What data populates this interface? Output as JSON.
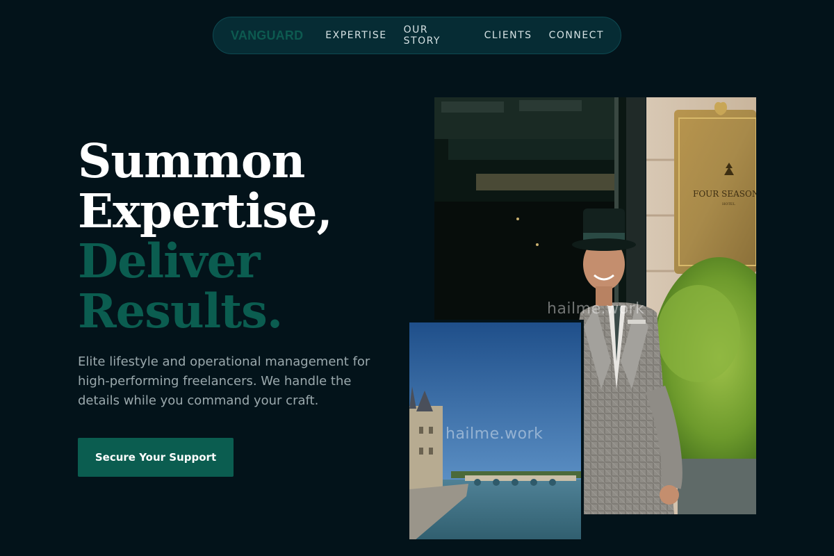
{
  "nav": {
    "brand": "VANGUARD",
    "links": [
      "EXPERTISE",
      "OUR STORY",
      "CLIENTS",
      "CONNECT"
    ]
  },
  "hero": {
    "headline_line1": "Summon",
    "headline_line2": "Expertise,",
    "headline_line3": "Deliver",
    "headline_line4": "Results.",
    "tagline": "Elite lifestyle and operational management for high-performing freelancers. We handle the details while you command your craft.",
    "cta_label": "Secure Your Support"
  },
  "images": {
    "main_sign_text": "FOUR SEASONS",
    "main_sign_sub": "HOTEL",
    "watermark": "hailme.work"
  },
  "colors": {
    "background": "#03131a",
    "accent": "#0b5d50",
    "nav_bg": "#062c34",
    "tagline": "#9ba9ad"
  }
}
